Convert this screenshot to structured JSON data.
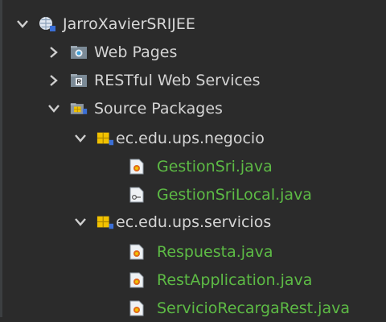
{
  "project_tree": {
    "root": {
      "label": "JarroXavierSRIJEE",
      "icon": "web-project-icon"
    },
    "nodes": [
      {
        "label": "Web Pages",
        "icon": "web-pages-folder-icon",
        "expanded": false
      },
      {
        "label": "RESTful Web Services",
        "icon": "restful-services-icon",
        "expanded": false
      },
      {
        "label": "Source Packages",
        "icon": "source-packages-icon",
        "expanded": true
      }
    ],
    "packages": [
      {
        "label": "ec.edu.ups.negocio",
        "icon": "package-icon",
        "files": [
          {
            "label": "GestionSri.java",
            "icon": "java-class-icon"
          },
          {
            "label": "GestionSriLocal.java",
            "icon": "java-interface-icon"
          }
        ]
      },
      {
        "label": "ec.edu.ups.servicios",
        "icon": "package-icon",
        "files": [
          {
            "label": "Respuesta.java",
            "icon": "java-class-icon"
          },
          {
            "label": "RestApplication.java",
            "icon": "java-class-icon"
          },
          {
            "label": "ServicioRecargaRest.java",
            "icon": "java-class-icon"
          }
        ]
      }
    ],
    "colors": {
      "background": "#2b2b2b",
      "text": "#d4d4d4",
      "new_file_text": "#5dbb45"
    }
  }
}
